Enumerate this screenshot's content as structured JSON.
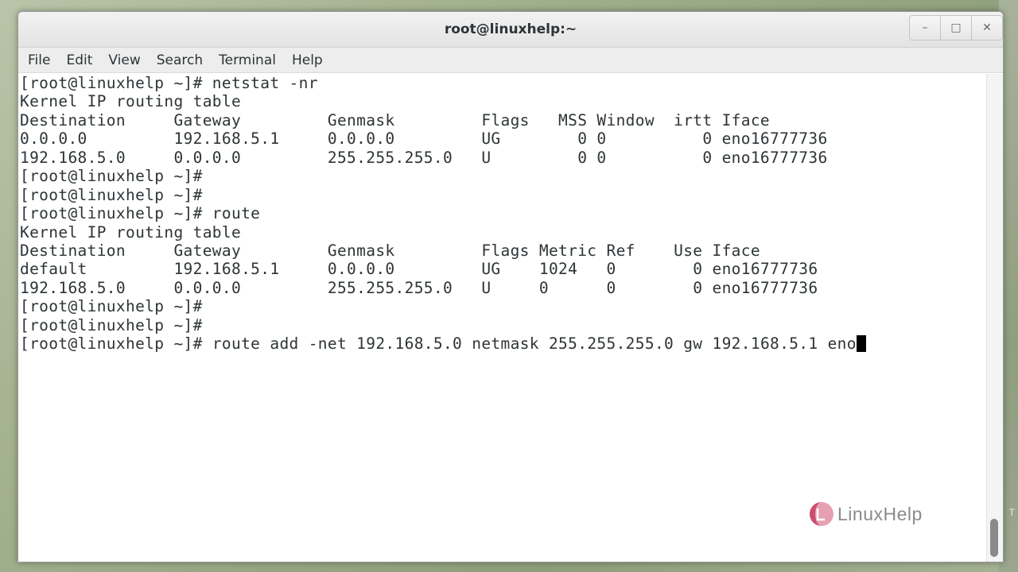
{
  "window": {
    "title": "root@linuxhelp:~",
    "controls": {
      "minimize_icon": "minimize-icon",
      "maximize_icon": "maximize-icon",
      "close_icon": "close-icon"
    }
  },
  "menubar": {
    "items": [
      {
        "label": "File"
      },
      {
        "label": "Edit"
      },
      {
        "label": "View"
      },
      {
        "label": "Search"
      },
      {
        "label": "Terminal"
      },
      {
        "label": "Help"
      }
    ]
  },
  "terminal": {
    "lines": [
      "[root@linuxhelp ~]# netstat -nr",
      "Kernel IP routing table",
      "Destination     Gateway         Genmask         Flags   MSS Window  irtt Iface",
      "0.0.0.0         192.168.5.1     0.0.0.0         UG        0 0          0 eno16777736",
      "192.168.5.0     0.0.0.0         255.255.255.0   U         0 0          0 eno16777736",
      "[root@linuxhelp ~]#",
      "[root@linuxhelp ~]#",
      "[root@linuxhelp ~]# route",
      "Kernel IP routing table",
      "Destination     Gateway         Genmask         Flags Metric Ref    Use Iface",
      "default         192.168.5.1     0.0.0.0         UG    1024   0        0 eno16777736",
      "192.168.5.0     0.0.0.0         255.255.255.0   U     0      0        0 eno16777736",
      "[root@linuxhelp ~]#",
      "[root@linuxhelp ~]#"
    ],
    "current_prompt": "[root@linuxhelp ~]# ",
    "current_input": "route add -net 192.168.5.0 netmask 255.255.255.0 gw 192.168.5.1 eno"
  },
  "watermark": {
    "text": "LinuxHelp",
    "logo_colors": [
      "#c94f6d",
      "#e7a0b2"
    ]
  },
  "desktop": {
    "edge_glyph": "T"
  },
  "theme": {
    "terminal_fg": "#2e3436",
    "terminal_bg": "#ffffff",
    "cursor": "#000000"
  }
}
